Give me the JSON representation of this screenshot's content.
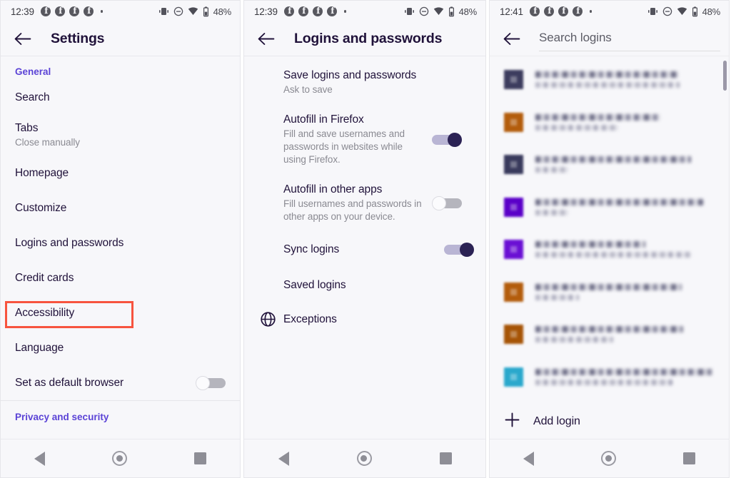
{
  "statusbar": {
    "time_left": "12:39",
    "time_right": "12:41",
    "notification_icons": [
      "facebook-icon",
      "facebook-icon",
      "facebook-icon",
      "facebook-icon",
      "more-dot-icon"
    ],
    "status_icons": [
      "vibrate-icon",
      "do-not-disturb-icon",
      "wifi-icon",
      "battery-icon"
    ],
    "battery_percent": "48%"
  },
  "navbar": {
    "back_label": "Back",
    "home_label": "Home",
    "recents_label": "Recent apps"
  },
  "colors": {
    "accent_purple": "#5b43d6",
    "title_dark": "#20123a",
    "toggle_on": "#2b2254",
    "highlight_red": "#f7543f",
    "background": "#f7f7fa"
  },
  "panel1": {
    "title": "Settings",
    "back_icon": "arrow-left-icon",
    "sections": [
      {
        "header": "General",
        "items": [
          {
            "title": "Search",
            "subtitle": ""
          },
          {
            "title": "Tabs",
            "subtitle": "Close manually"
          },
          {
            "title": "Homepage",
            "subtitle": ""
          },
          {
            "title": "Customize",
            "subtitle": ""
          },
          {
            "title": "Logins and passwords",
            "subtitle": "",
            "highlighted": true
          },
          {
            "title": "Credit cards",
            "subtitle": ""
          },
          {
            "title": "Accessibility",
            "subtitle": ""
          },
          {
            "title": "Language",
            "subtitle": ""
          },
          {
            "title": "Set as default browser",
            "subtitle": "",
            "toggle": "off"
          }
        ]
      },
      {
        "header": "Privacy and security",
        "items": []
      }
    ]
  },
  "panel2": {
    "title": "Logins and passwords",
    "back_icon": "arrow-left-icon",
    "items": [
      {
        "title": "Save logins and passwords",
        "subtitle": "Ask to save"
      },
      {
        "title": "Autofill in Firefox",
        "subtitle": "Fill and save usernames and passwords in websites while using Firefox.",
        "toggle": "on"
      },
      {
        "title": "Autofill in other apps",
        "subtitle": "Fill usernames and passwords in other apps on your device.",
        "toggle": "off"
      },
      {
        "title": "Sync logins",
        "subtitle": "",
        "toggle": "on"
      },
      {
        "title": "Saved logins",
        "subtitle": "",
        "highlighted": true
      },
      {
        "title": "Exceptions",
        "subtitle": "",
        "icon": "globe-icon"
      }
    ]
  },
  "panel3": {
    "back_icon": "arrow-left-icon",
    "search_placeholder": "Search logins",
    "search_value": "",
    "login_items": [
      {
        "favicon_color": "#3c3c5e",
        "title_redacted": true,
        "subtitle_redacted": true
      },
      {
        "favicon_color": "#b35c0c",
        "title_redacted": true,
        "subtitle_redacted": true
      },
      {
        "favicon_color": "#393a5c",
        "title_redacted": true,
        "subtitle_redacted": true
      },
      {
        "favicon_color": "#5a00c8",
        "title_redacted": true,
        "subtitle_redacted": true
      },
      {
        "favicon_color": "#6a10d4",
        "title_redacted": true,
        "subtitle_redacted": true
      },
      {
        "favicon_color": "#b35c0c",
        "title_redacted": true,
        "subtitle_redacted": true
      },
      {
        "favicon_color": "#a65406",
        "title_redacted": true,
        "subtitle_redacted": true
      },
      {
        "favicon_color": "#2aa8cc",
        "title_redacted": true,
        "subtitle_redacted": true
      },
      {
        "favicon_color": "#1f9ec4",
        "title_redacted": true,
        "subtitle_redacted": true
      }
    ],
    "add_login_label": "Add login",
    "add_icon": "plus-icon"
  }
}
